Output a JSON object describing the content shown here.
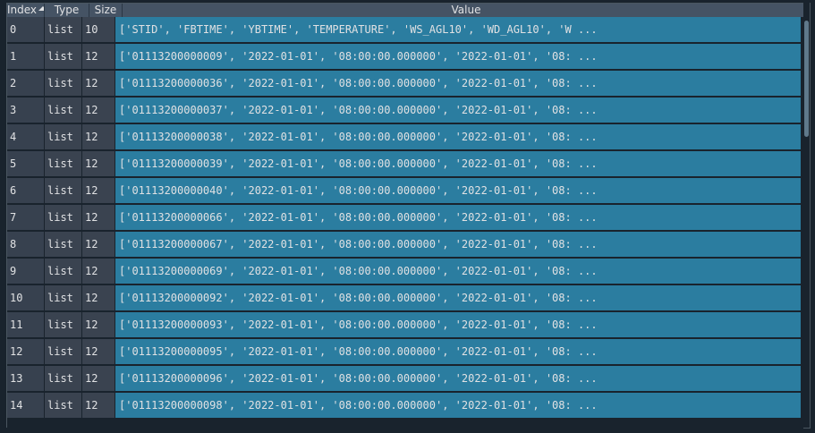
{
  "table": {
    "headers": [
      "Index",
      "Type",
      "Size",
      "Value"
    ],
    "rows": [
      {
        "index": "0",
        "type": "list",
        "size": "10",
        "value": "['STID', 'FBTIME', 'YBTIME', 'TEMPERATURE', 'WS_AGL10', 'WD_AGL10', 'W ..."
      },
      {
        "index": "1",
        "type": "list",
        "size": "12",
        "value": "['01113200000009', '2022-01-01', '08:00:00.000000', '2022-01-01', '08: ..."
      },
      {
        "index": "2",
        "type": "list",
        "size": "12",
        "value": "['01113200000036', '2022-01-01', '08:00:00.000000', '2022-01-01', '08: ..."
      },
      {
        "index": "3",
        "type": "list",
        "size": "12",
        "value": "['01113200000037', '2022-01-01', '08:00:00.000000', '2022-01-01', '08: ..."
      },
      {
        "index": "4",
        "type": "list",
        "size": "12",
        "value": "['01113200000038', '2022-01-01', '08:00:00.000000', '2022-01-01', '08: ..."
      },
      {
        "index": "5",
        "type": "list",
        "size": "12",
        "value": "['01113200000039', '2022-01-01', '08:00:00.000000', '2022-01-01', '08: ..."
      },
      {
        "index": "6",
        "type": "list",
        "size": "12",
        "value": "['01113200000040', '2022-01-01', '08:00:00.000000', '2022-01-01', '08: ..."
      },
      {
        "index": "7",
        "type": "list",
        "size": "12",
        "value": "['01113200000066', '2022-01-01', '08:00:00.000000', '2022-01-01', '08: ..."
      },
      {
        "index": "8",
        "type": "list",
        "size": "12",
        "value": "['01113200000067', '2022-01-01', '08:00:00.000000', '2022-01-01', '08: ..."
      },
      {
        "index": "9",
        "type": "list",
        "size": "12",
        "value": "['01113200000069', '2022-01-01', '08:00:00.000000', '2022-01-01', '08: ..."
      },
      {
        "index": "10",
        "type": "list",
        "size": "12",
        "value": "['01113200000092', '2022-01-01', '08:00:00.000000', '2022-01-01', '08: ..."
      },
      {
        "index": "11",
        "type": "list",
        "size": "12",
        "value": "['01113200000093', '2022-01-01', '08:00:00.000000', '2022-01-01', '08: ..."
      },
      {
        "index": "12",
        "type": "list",
        "size": "12",
        "value": "['01113200000095', '2022-01-01', '08:00:00.000000', '2022-01-01', '08: ..."
      },
      {
        "index": "13",
        "type": "list",
        "size": "12",
        "value": "['01113200000096', '2022-01-01', '08:00:00.000000', '2022-01-01', '08: ..."
      },
      {
        "index": "14",
        "type": "list",
        "size": "12",
        "value": "['01113200000098', '2022-01-01', '08:00:00.000000', '2022-01-01', '08: ..."
      }
    ],
    "sort_icon": "sort-ascending-icon"
  },
  "colors": {
    "background": "#19232d",
    "header": "#455364",
    "value_cell": "#2b7da0",
    "text": "#e0e1e3"
  }
}
